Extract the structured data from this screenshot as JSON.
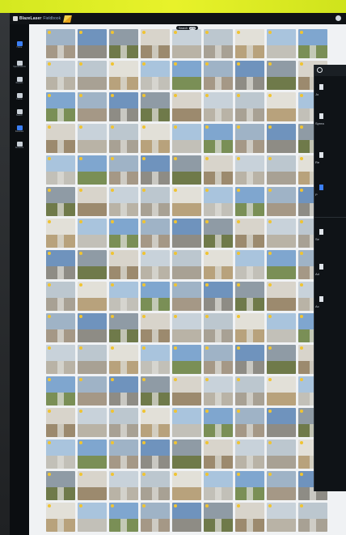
{
  "window": {
    "app_name": "BlazeLaser",
    "module_name": "Fieldbook"
  },
  "search": {
    "label": "Search",
    "count": "270"
  },
  "sidebar": {
    "items": [
      {
        "label": "Home",
        "icon": "home-icon",
        "active": true
      },
      {
        "label": "Specifications",
        "icon": "specifications-icon"
      },
      {
        "label": "Reports",
        "icon": "reports-icon"
      },
      {
        "label": "Forms",
        "icon": "forms-icon"
      },
      {
        "label": "Search",
        "icon": "search-icon"
      },
      {
        "label": "Favorites",
        "icon": "plus-icon"
      },
      {
        "label": "Accounts",
        "icon": "accounts-icon"
      }
    ]
  },
  "side_panel": {
    "items": [
      {
        "text": "Jo",
        "icon": "document-icon"
      },
      {
        "text": "Sprea",
        "icon": "spreadsheet-icon"
      },
      {
        "text": "Re",
        "icon": "reports-icon"
      },
      {
        "text": "P",
        "icon": "photo-icon",
        "active": true
      },
      {
        "text": "Se",
        "icon": "settings-icon"
      },
      {
        "text": "Ad",
        "icon": "add-icon"
      },
      {
        "text": "Ac",
        "icon": "accounts-icon"
      }
    ]
  },
  "photos": {
    "count": 144,
    "palette": [
      {
        "sky": "#9fb3c6",
        "ground": "#a59886"
      },
      {
        "sky": "#c8d2da",
        "ground": "#b9b3a6"
      },
      {
        "sky": "#7fa6cf",
        "ground": "#7a8f56"
      },
      {
        "sky": "#d8d4cb",
        "ground": "#9c8a6e"
      },
      {
        "sky": "#a9c4dd",
        "ground": "#c2c0b8"
      },
      {
        "sky": "#8f9ba5",
        "ground": "#6f7a4a"
      },
      {
        "sky": "#e2e0d8",
        "ground": "#b8a27c"
      },
      {
        "sky": "#6f93bd",
        "ground": "#8e8c85"
      },
      {
        "sky": "#bcc7cf",
        "ground": "#a8a194"
      }
    ]
  }
}
